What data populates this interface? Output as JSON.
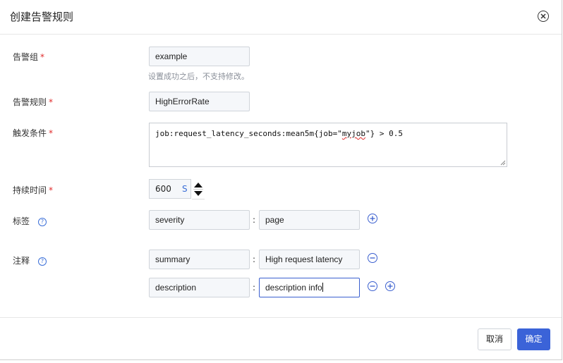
{
  "dialog": {
    "title": "创建告警规则"
  },
  "form": {
    "group": {
      "label": "告警组",
      "value": "example",
      "hint": "设置成功之后，不支持修改。"
    },
    "rule": {
      "label": "告警规则",
      "value": "HighErrorRate"
    },
    "condition": {
      "label": "触发条件",
      "prefix": "job:request_latency_seconds:mean5m{job=\"",
      "misspelled": "myjob",
      "suffix": "\"} > 0.5"
    },
    "duration": {
      "label": "持续时间",
      "value": "600",
      "unit": "S"
    },
    "labels": {
      "label": "标签",
      "items": [
        {
          "key": "severity",
          "value": "page"
        }
      ]
    },
    "annotations": {
      "label": "注释",
      "items": [
        {
          "key": "summary",
          "value": "High request latency"
        },
        {
          "key": "description",
          "value": "description info"
        }
      ]
    },
    "required_mark": "*",
    "separator": ":",
    "help_glyph": "?"
  },
  "footer": {
    "cancel_label": "取消",
    "confirm_label": "确定"
  },
  "colors": {
    "primary": "#3b63d8",
    "required": "#e02a2a",
    "input_bg": "#f5f7fa"
  },
  "icons": [
    "close-icon",
    "help-icon",
    "plus-circle-icon",
    "minus-circle-icon",
    "caret-up-icon",
    "caret-down-icon"
  ]
}
